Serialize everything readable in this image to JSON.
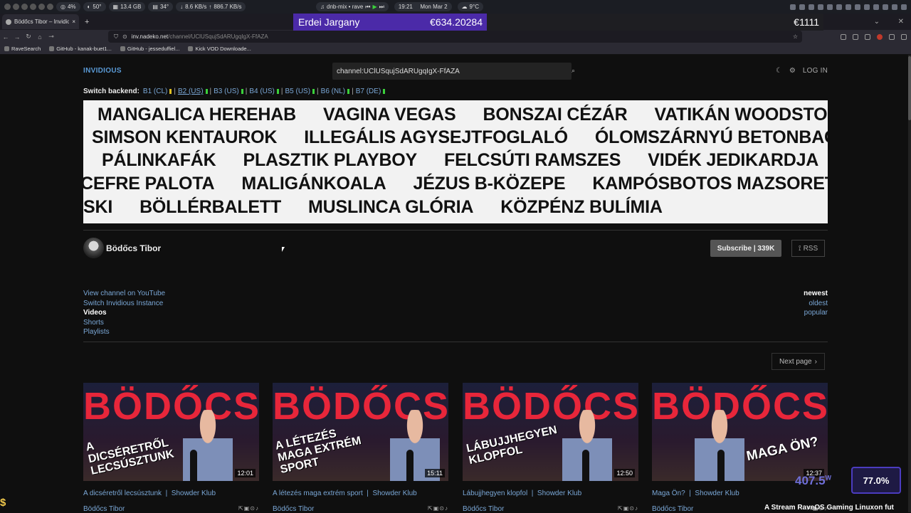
{
  "system_bar": {
    "cpu": "4%",
    "temp1": "50°",
    "ram": "13.4 GB",
    "temp2": "34°",
    "down": "8.6 KB/s",
    "up": "886.7 KB/s",
    "media": "dnb-mix • rave",
    "time": "19:21",
    "date": "Mon Mar 2",
    "weather": "9°C"
  },
  "ticker": {
    "name": "Erdei Jargany",
    "amount": "€634.20284",
    "other": "€1111"
  },
  "browser": {
    "tab_title": "Bödőcs Tibor – Invidious",
    "url_domain": "inv.nadeko.net",
    "url_path": "/channel/UClUSqujSdARUgqIgX-FfAZA",
    "bookmarks": [
      "RaveSearch",
      "GitHub - kanak-buet1...",
      "GitHub - jesseduffiel...",
      "Kick VOD Downloade..."
    ]
  },
  "header": {
    "logo": "INVIDIOUS",
    "search_value": "channel:UClUSqujSdARUgqIgX-FfAZA",
    "login": "LOG IN"
  },
  "backend": {
    "label": "Switch backend:",
    "items": [
      {
        "label": "B1 (CL)",
        "status": "#e0c022"
      },
      {
        "label": "B2 (US)",
        "status": "#3bd13b"
      },
      {
        "label": "B3 (US)",
        "status": "#3bd13b"
      },
      {
        "label": "B4 (US)",
        "status": "#3bd13b"
      },
      {
        "label": "B5 (US)",
        "status": "#3bd13b"
      },
      {
        "label": "B6 (NL)",
        "status": "#3bd13b"
      },
      {
        "label": "B7 (DE)",
        "status": "#3bd13b"
      }
    ]
  },
  "banner": {
    "rows": [
      [
        "MANGALICA HEREHAB",
        "VAGINA VEGAS",
        "BONSZAI CÉZÁR",
        "VATIKÁN WOODSTOCK"
      ],
      [
        "SIMSON KENTAUROK",
        "ILLEGÁLIS AGYSEJTFOGLALÓ",
        "ÓLOMSZÁRNYÚ BETONBAGOLY"
      ],
      [
        "PÁLINKAFÁK",
        "PLASZTIK PLAYBOY",
        "FELCSÚTI RAMSZES",
        "VIDÉK JEDIKARDJA"
      ],
      [
        "CEFRE PALOTA",
        "MALIGÁNKOALA",
        "JÉZUS B-KÖZEPE",
        "KAMPÓSBOTOS MAZSORETTEK"
      ],
      [
        "SKI",
        "BÖLLÉRBALETT",
        "MUSLINCA GLÓRIA",
        "KÖZPÉNZ BULÍMIA"
      ]
    ]
  },
  "channel": {
    "name": "Bödőcs Tibor",
    "subscribe": "Subscribe | 339K",
    "rss": "RSS"
  },
  "channel_links": [
    "View channel on YouTube",
    "Switch Invidious Instance",
    "Videos",
    "Shorts",
    "Playlists"
  ],
  "sort": [
    "newest",
    "oldest",
    "popular"
  ],
  "pagination": {
    "next": "Next page"
  },
  "videos": [
    {
      "title": "A dicséretről lecsúsztunk",
      "series": "Showder Klub",
      "author": "Bödőcs Tibor",
      "duration": "12:01",
      "caption": "A DICSÉRETRŐL LECSÚSZTUNK",
      "brand": "BÖDŐCS"
    },
    {
      "title": "A létezés maga extrém sport",
      "series": "Showder Klub",
      "author": "Bödőcs Tibor",
      "duration": "15:11",
      "caption": "A LÉTEZÉS MAGA EXTRÉM SPORT",
      "brand": "BÖDŐCS"
    },
    {
      "title": "Lábujjhegyen klopfol",
      "series": "Showder Klub",
      "author": "Bödőcs Tibor",
      "duration": "12:50",
      "caption": "LÁBUJJHEGYEN KLOPFOL",
      "brand": "BÖDŐCS"
    },
    {
      "title": "Maga Ön?",
      "series": "Showder Klub",
      "author": "Bödőcs Tibor",
      "duration": "12:37",
      "caption": "MAGA ÖN?",
      "brand": "BÖDŐCS"
    }
  ],
  "overlay": {
    "watts": "407.5",
    "watts_unit": "W",
    "percent": "77.0%",
    "ticker_text": "A Stream RaveOS Gaming Linuxon fut"
  }
}
